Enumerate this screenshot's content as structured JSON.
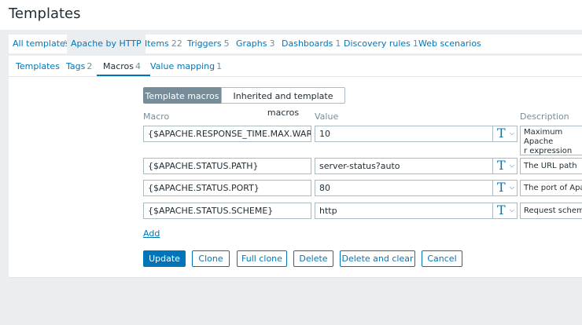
{
  "page": {
    "title": "Templates"
  },
  "nav": {
    "all_templates": "All templates",
    "separator": "/",
    "current_template": "Apache by HTTP",
    "items": [
      {
        "label": "Items",
        "count": "22"
      },
      {
        "label": "Triggers",
        "count": "5"
      },
      {
        "label": "Graphs",
        "count": "3"
      },
      {
        "label": "Dashboards",
        "count": "1"
      },
      {
        "label": "Discovery rules",
        "count": "1"
      },
      {
        "label": "Web scenarios",
        "count": ""
      }
    ]
  },
  "tabs": [
    {
      "label": "Templates",
      "count": ""
    },
    {
      "label": "Tags",
      "count": "2"
    },
    {
      "label": "Macros",
      "count": "4"
    },
    {
      "label": "Value mapping",
      "count": "1"
    }
  ],
  "macro_view": {
    "template_macros_label": "Template macros",
    "inherited_macros_label": "Inherited and template macros"
  },
  "columns": {
    "macro": "Macro",
    "value": "Value",
    "description": "Description"
  },
  "macros": [
    {
      "macro": "{$APACHE.RESPONSE_TIME.MAX.WARN}",
      "value": "10",
      "type_glyph": "T",
      "description": "Maximum Apache response time in seconds for trigger expression"
    },
    {
      "macro": "{$APACHE.STATUS.PATH}",
      "value": "server-status?auto",
      "type_glyph": "T",
      "description": "The URL path"
    },
    {
      "macro": "{$APACHE.STATUS.PORT}",
      "value": "80",
      "type_glyph": "T",
      "description": "The port of Apache status page"
    },
    {
      "macro": "{$APACHE.STATUS.SCHEME}",
      "value": "http",
      "type_glyph": "T",
      "description": "Request scheme which may be http or https"
    }
  ],
  "desc_visible": [
    "Maximum Apache\nr expression",
    "The URL path",
    "The port of Apac",
    "Request scheme"
  ],
  "add_label": "Add",
  "buttons": {
    "update": "Update",
    "clone": "Clone",
    "full_clone": "Full clone",
    "delete": "Delete",
    "delete_and_clear": "Delete and clear",
    "cancel": "Cancel"
  },
  "colors": {
    "accent": "#0275b8",
    "background": "#ebeef0",
    "muted": "#768d99",
    "border": "#acbbc2"
  }
}
